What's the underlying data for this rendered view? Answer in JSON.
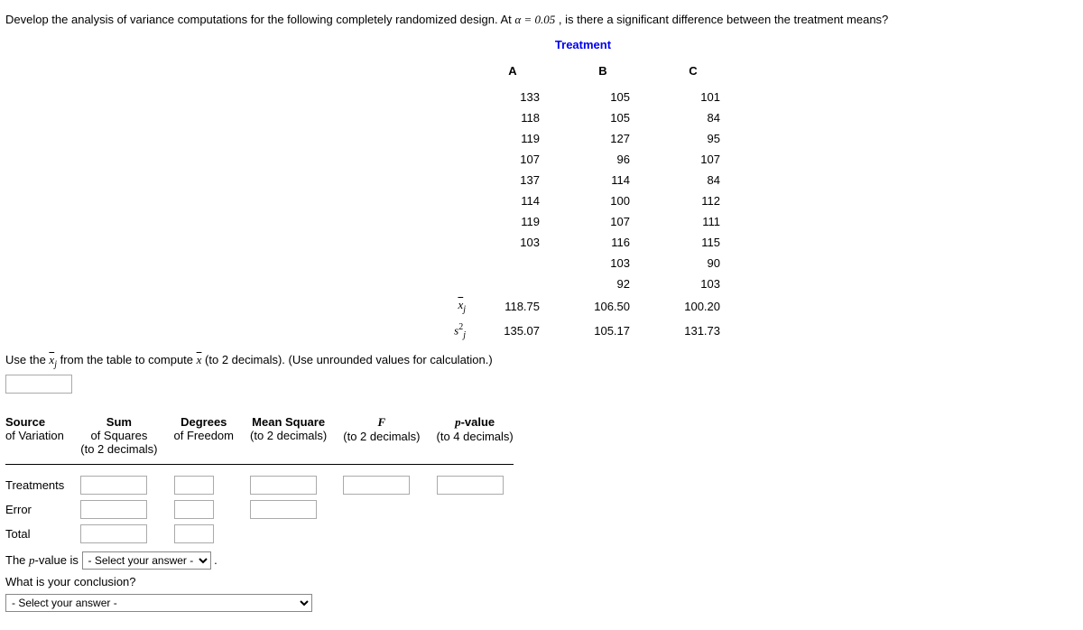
{
  "intro_prefix": "Develop the analysis of variance computations for the following completely randomized design. At ",
  "alpha_expr": "α = 0.05",
  "intro_suffix": ", is there a significant difference between the treatment means?",
  "treatment_header": "Treatment",
  "data_table": {
    "cols": [
      "A",
      "B",
      "C"
    ],
    "rows": [
      [
        "133",
        "105",
        "101"
      ],
      [
        "118",
        "105",
        "84"
      ],
      [
        "119",
        "127",
        "95"
      ],
      [
        "107",
        "96",
        "107"
      ],
      [
        "137",
        "114",
        "84"
      ],
      [
        "114",
        "100",
        "112"
      ],
      [
        "119",
        "107",
        "111"
      ],
      [
        "103",
        "116",
        "115"
      ],
      [
        "",
        "103",
        "90"
      ],
      [
        "",
        "92",
        "103"
      ]
    ],
    "mean_row": [
      "118.75",
      "106.50",
      "100.20"
    ],
    "var_row": [
      "135.07",
      "105.17",
      "131.73"
    ]
  },
  "use_hint_prefix": "Use the ",
  "use_hint_mid": " from the table to compute ",
  "use_hint_suffix": " (to 2 decimals). (Use unrounded values for calculation.)",
  "anova": {
    "headers": {
      "source1": "Source",
      "source2": "of Variation",
      "sum1": "Sum",
      "sum2": "of Squares",
      "sum3": "(to 2 decimals)",
      "df1": "Degrees",
      "df2": "of Freedom",
      "ms1": "Mean Square",
      "ms2": "(to 2 decimals)",
      "f1": "F",
      "f2": "(to 2 decimals)",
      "p1": "p-value",
      "p2": "(to 4 decimals)"
    },
    "rows": [
      "Treatments",
      "Error",
      "Total"
    ]
  },
  "pvalue_label": "The p-value is ",
  "pvalue_select_placeholder": "- Select your answer -",
  "conclusion_q": "What is your conclusion?",
  "conclusion_select_placeholder": "- Select your answer -"
}
